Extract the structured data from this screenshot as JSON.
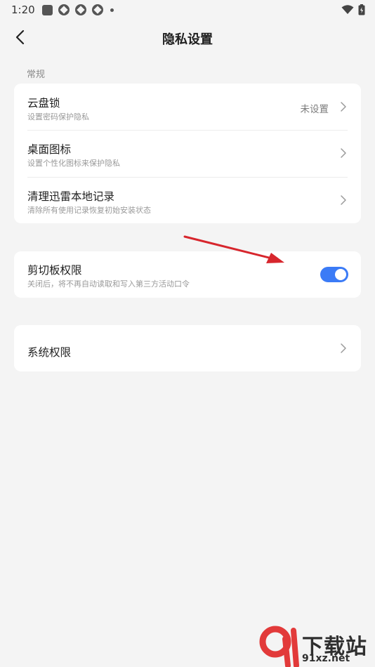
{
  "status_bar": {
    "time": "1:20"
  },
  "header": {
    "title": "隐私设置"
  },
  "sections": {
    "general_label": "常规"
  },
  "general_card": {
    "items": [
      {
        "title": "云盘锁",
        "subtitle": "设置密码保护隐私",
        "value": "未设置"
      },
      {
        "title": "桌面图标",
        "subtitle": "设置个性化图标来保护隐私"
      },
      {
        "title": "清理迅雷本地记录",
        "subtitle": "清除所有使用记录恢复初始安装状态"
      }
    ]
  },
  "clipboard_card": {
    "title": "剪切板权限",
    "subtitle": "关闭后，将不再自动读取和写入第三方活动口令",
    "toggle_on": true
  },
  "system_card": {
    "title": "系统权限"
  },
  "watermark": {
    "top": "下载站",
    "bottom": "91xz.net"
  },
  "colors": {
    "accent": "#3b7bf6",
    "annotation_arrow": "#d7262d"
  }
}
